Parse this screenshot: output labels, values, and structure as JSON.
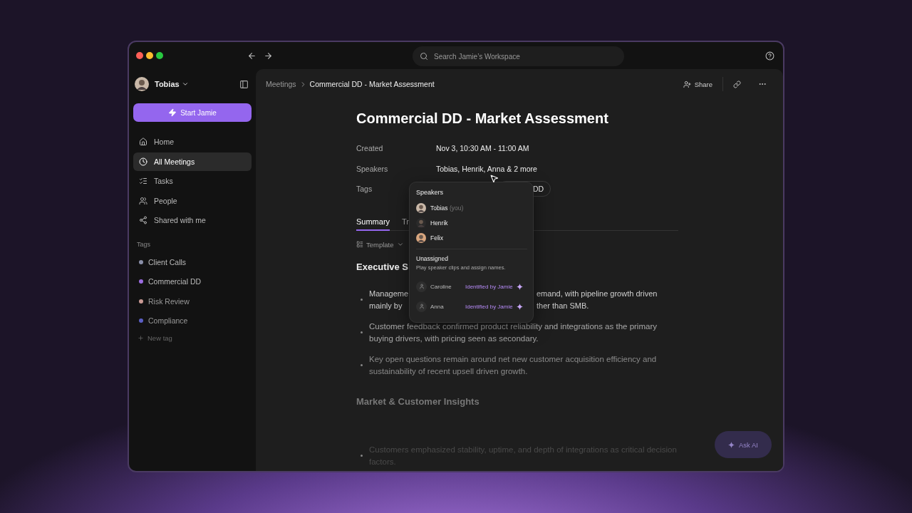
{
  "window": {
    "search_placeholder": "Search Jamie’s Workspace"
  },
  "sidebar": {
    "user": "Tobias",
    "start_button": "Start Jamie",
    "nav": [
      {
        "label": "Home",
        "selected": false
      },
      {
        "label": "All Meetings",
        "selected": true
      },
      {
        "label": "Tasks",
        "selected": false
      },
      {
        "label": "People",
        "selected": false
      },
      {
        "label": "Shared with me",
        "selected": false
      }
    ],
    "tags_heading": "Tags",
    "tags": [
      {
        "label": "Client Calls",
        "color": "#8a8fa8"
      },
      {
        "label": "Commercial DD",
        "color": "#9b6ce0"
      },
      {
        "label": "Risk Review",
        "color": "#c99a94"
      },
      {
        "label": "Compliance",
        "color": "#5b5fc4"
      }
    ],
    "new_tag": "New tag"
  },
  "header": {
    "breadcrumb": [
      "Meetings",
      "Commercial DD - Market Assessment"
    ],
    "share": "Share"
  },
  "meeting": {
    "title": "Commercial DD - Market Assessment",
    "fields": [
      {
        "label": "Created",
        "kind": "text",
        "value": "Nov 3, 10:30 AM - 11:00 AM"
      },
      {
        "label": "Speakers",
        "kind": "text",
        "value": "Tobias, Henrik, Anna & 2 more"
      },
      {
        "label": "Tags",
        "kind": "tag",
        "value": "DD"
      }
    ]
  },
  "tabs": [
    {
      "label": "Summary",
      "selected": true
    },
    {
      "label": "Tr",
      "selected": false
    }
  ],
  "template": "Template",
  "sections": [
    {
      "heading": "Executive S",
      "bullets": [
        {
          "kind": "split",
          "lines": [
            [
              "Manageme",
              "emand, with pipeline growth driven"
            ],
            [
              "mainly by",
              "ther than SMB."
            ]
          ]
        },
        {
          "kind": "text",
          "text": "Customer feedback confirmed product reliability and integrations as the primary buying drivers, with pricing seen as secondary."
        },
        {
          "kind": "text",
          "text": "Key open questions remain around net new customer acquisition efficiency and sustainability of recent upsell driven growth."
        }
      ]
    },
    {
      "heading": "Market & Customer Insights",
      "bullets": [
        {
          "kind": "text",
          "text": "Customers emphasized stability, uptime, and depth of integrations as critical decision factors."
        }
      ]
    }
  ],
  "ask_ai": "Ask AI",
  "popover": {
    "heading": "Speakers",
    "speakers": [
      {
        "name": "Tobias",
        "note": "(you)"
      },
      {
        "name": "Henrik"
      },
      {
        "name": "Felix"
      }
    ],
    "unassigned_heading": "Unassigned",
    "unassigned_hint": "Play speaker clips and assign names.",
    "unassigned": [
      {
        "name": "Caroline",
        "badge": "Identified by Jamie"
      },
      {
        "name": "Anna",
        "badge": "Identified by Jamie"
      }
    ]
  }
}
